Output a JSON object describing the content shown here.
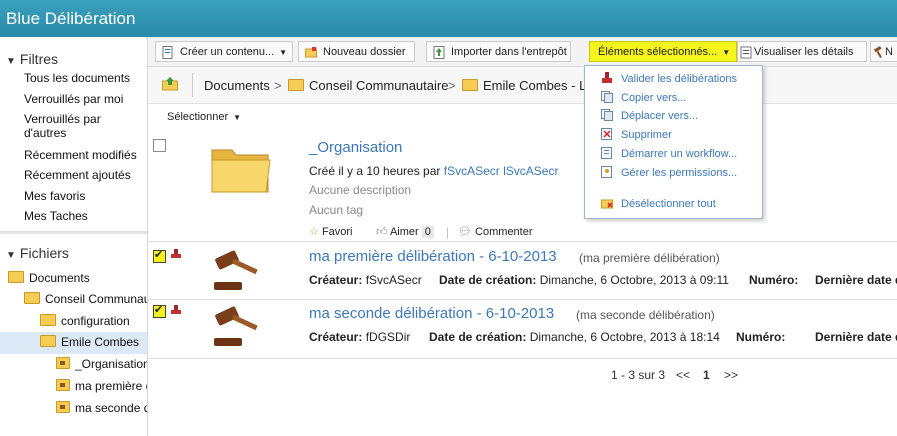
{
  "app": {
    "title": "Blue Délibération"
  },
  "sidebar": {
    "filters_header": "Filtres",
    "filters": [
      "Tous les documents",
      "Verrouillés par moi",
      "Verrouillés par d'autres",
      "Récemment modifiés",
      "Récemment ajoutés",
      "Mes favoris",
      "Mes Taches"
    ],
    "files_header": "Fichiers",
    "tree": [
      "Documents",
      "Conseil Communautaire",
      "configuration",
      "Emile Combes",
      "_Organisation",
      "ma première délibération",
      "ma seconde délibération"
    ]
  },
  "toolbar": {
    "create": "Créer un contenu...",
    "new_folder": "Nouveau dossier",
    "import": "Importer dans l'entrepôt",
    "selected_items": "Éléments sélectionnés...",
    "view_details": "Visualiser les détails",
    "overflow": "N"
  },
  "breadcrumb": [
    "Documents",
    "Conseil Communautaire",
    "Emile Combes - La..."
  ],
  "breadcrumb_sep": ">",
  "select_label": "Sélectionner",
  "dropdown": {
    "items": [
      "Valider les délibérations",
      "Copier vers...",
      "Déplacer vers...",
      "Supprimer",
      "Démarrer un workflow...",
      "Gérer les permissions...",
      "Désélectionner tout"
    ]
  },
  "items": {
    "folder": {
      "name": "_Organisation",
      "created_prefix": "Créé il y a 10 heures par",
      "created_by": "fSvcASecr lSvcASecr",
      "no_description": "Aucune description",
      "no_tag": "Aucun tag",
      "favorite": "Favori",
      "like": "Aimer",
      "like_count": "0",
      "comment": "Commenter"
    },
    "doc1": {
      "name": "ma première délibération - 6-10-2013",
      "title": "(ma première délibération)",
      "creator_label": "Créateur:",
      "creator": "fSvcASecr",
      "date_label": "Date de création:",
      "date": "Dimanche, 6 Octobre, 2013 à 09:11",
      "number_label": "Numéro:",
      "last_date_label": "Dernière date d"
    },
    "doc2": {
      "name": "ma seconde délibération - 6-10-2013",
      "title": "(ma seconde délibération)",
      "creator_label": "Créateur:",
      "creator": "fDGSDir",
      "date_label": "Date de création:",
      "date": "Dimanche, 6 Octobre, 2013 à 18:14",
      "number_label": "Numéro:",
      "last_date_label": "Dernière date d"
    }
  },
  "pager": {
    "range": "1 - 3 sur 3",
    "prev": "<<",
    "current": "1",
    "next": ">>"
  },
  "colors": {
    "titlebar": "#2f93b1",
    "link": "#3d78b6",
    "highlight": "#f5f51e"
  }
}
